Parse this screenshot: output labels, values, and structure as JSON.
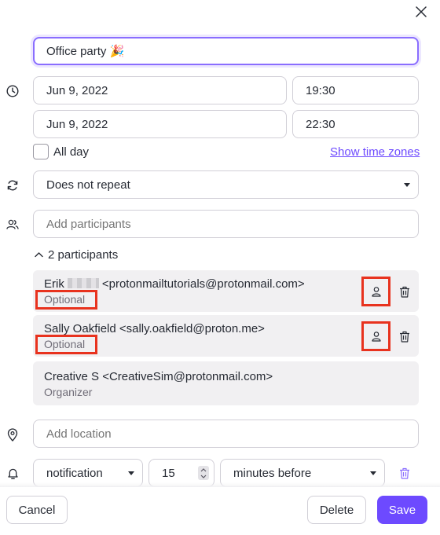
{
  "title_input": {
    "value": "Office party 🎉"
  },
  "start": {
    "date": "Jun 9, 2022",
    "time": "19:30"
  },
  "end": {
    "date": "Jun 9, 2022",
    "time": "22:30"
  },
  "all_day": {
    "label": "All day",
    "checked": false
  },
  "show_time_zones": "Show time zones",
  "repeat": {
    "value": "Does not repeat"
  },
  "participants_input": {
    "placeholder": "Add participants"
  },
  "participants_toggle": "2 participants",
  "participants": [
    {
      "name_first": "Erik",
      "email": "<protonmailtutorials@protonmail.com>",
      "role": "Optional"
    },
    {
      "name": "Sally Oakfield <sally.oakfield@proton.me>",
      "role": "Optional"
    },
    {
      "name": "Creative S <CreativeSim@protonmail.com>",
      "role": "Organizer"
    }
  ],
  "location_input": {
    "placeholder": "Add location"
  },
  "notification": {
    "type": "notification",
    "amount": "15",
    "unit": "minutes before"
  },
  "footer": {
    "cancel": "Cancel",
    "delete": "Delete",
    "save": "Save"
  },
  "colors": {
    "accent": "#6d4aff",
    "highlight": "#e8321e",
    "participant_bg": "#f1f0f2"
  },
  "icons": [
    "close-icon",
    "clock-icon",
    "repeat-icon",
    "participants-icon",
    "chevron-up-icon",
    "user-icon",
    "trash-icon",
    "location-icon",
    "bell-icon"
  ]
}
